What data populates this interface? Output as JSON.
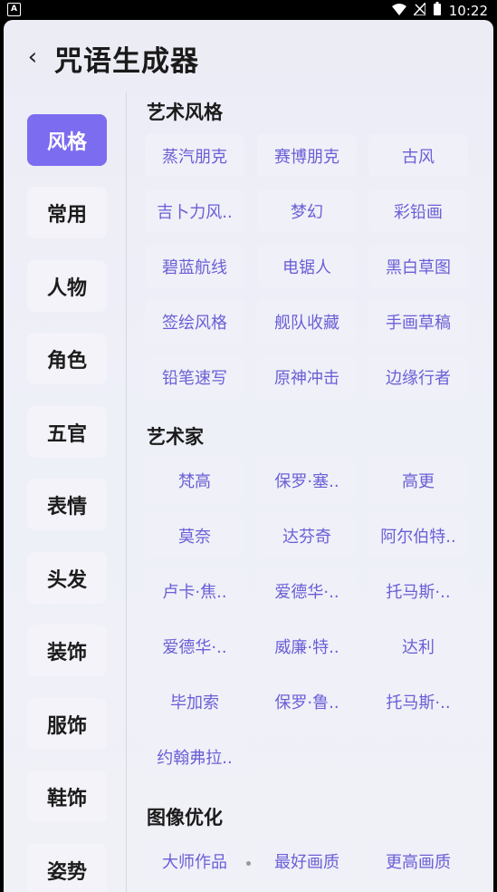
{
  "status": {
    "time": "10:22",
    "left_badge": "A"
  },
  "header": {
    "back": "‹",
    "title": "咒语生成器"
  },
  "sidebar": {
    "items": [
      {
        "label": "风格"
      },
      {
        "label": "常用"
      },
      {
        "label": "人物"
      },
      {
        "label": "角色"
      },
      {
        "label": "五官"
      },
      {
        "label": "表情"
      },
      {
        "label": "头发"
      },
      {
        "label": "装饰"
      },
      {
        "label": "服饰"
      },
      {
        "label": "鞋饰"
      },
      {
        "label": "姿势"
      }
    ]
  },
  "sections": [
    {
      "title": "艺术风格",
      "chips": [
        "蒸汽朋克",
        "赛博朋克",
        "古风",
        "吉卜力风..",
        "梦幻",
        "彩铅画",
        "碧蓝航线",
        "电锯人",
        "黑白草图",
        "签绘风格",
        "舰队收藏",
        "手画草稿",
        "铅笔速写",
        "原神冲击",
        "边缘行者"
      ]
    },
    {
      "title": "艺术家",
      "chips": [
        "梵高",
        "保罗·塞..",
        "高更",
        "莫奈",
        "达芬奇",
        "阿尔伯特..",
        "卢卡·焦..",
        "爱德华·..",
        "托马斯·..",
        "爱德华·..",
        "威廉·特..",
        "达利",
        "毕加索",
        "保罗·鲁..",
        "托马斯·..",
        "约翰弗拉.."
      ]
    },
    {
      "title": "图像优化",
      "chips": [
        "大师作品",
        "最好画质",
        "更高画质"
      ]
    }
  ],
  "colors": {
    "accent": "#7b6cf0",
    "chip_text": "#6a5fd6"
  }
}
